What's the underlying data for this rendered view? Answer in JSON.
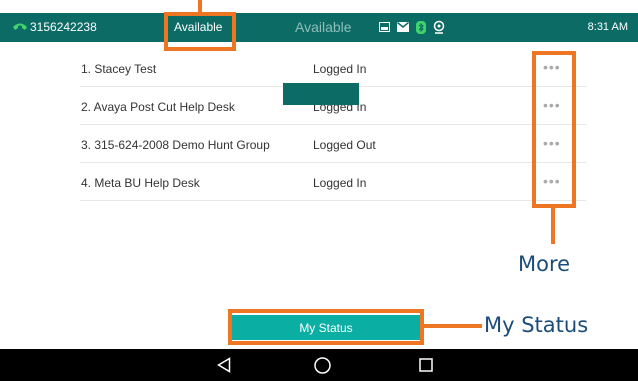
{
  "status_bar": {
    "phone_number": "3156242238",
    "left_status": "Available",
    "center_status": "Available",
    "time": "8:31 AM",
    "icons": [
      "phone-icon",
      "image-icon",
      "mail-icon",
      "bluetooth-icon",
      "location-icon"
    ]
  },
  "hunt_groups": [
    {
      "name": "1. Stacey Test",
      "status": "Logged In",
      "more": "•••"
    },
    {
      "name": "2. Avaya Post Cut Help Desk",
      "status": "Logged In",
      "more": "•••"
    },
    {
      "name": "3. 315-624-2008 Demo Hunt Group",
      "status": "Logged Out",
      "more": "•••"
    },
    {
      "name": "4. Meta BU Help Desk",
      "status": "Logged In",
      "more": "•••"
    }
  ],
  "my_status_button": "My Status",
  "nav": {
    "icons": [
      "back-icon",
      "home-icon",
      "recents-icon"
    ]
  },
  "annotations": {
    "more": "More",
    "my_status": "My Status"
  },
  "colors": {
    "header": "#0d6b66",
    "button": "#0aaea3",
    "callout": "#ee7623",
    "callout_text": "#1c4d7a"
  }
}
